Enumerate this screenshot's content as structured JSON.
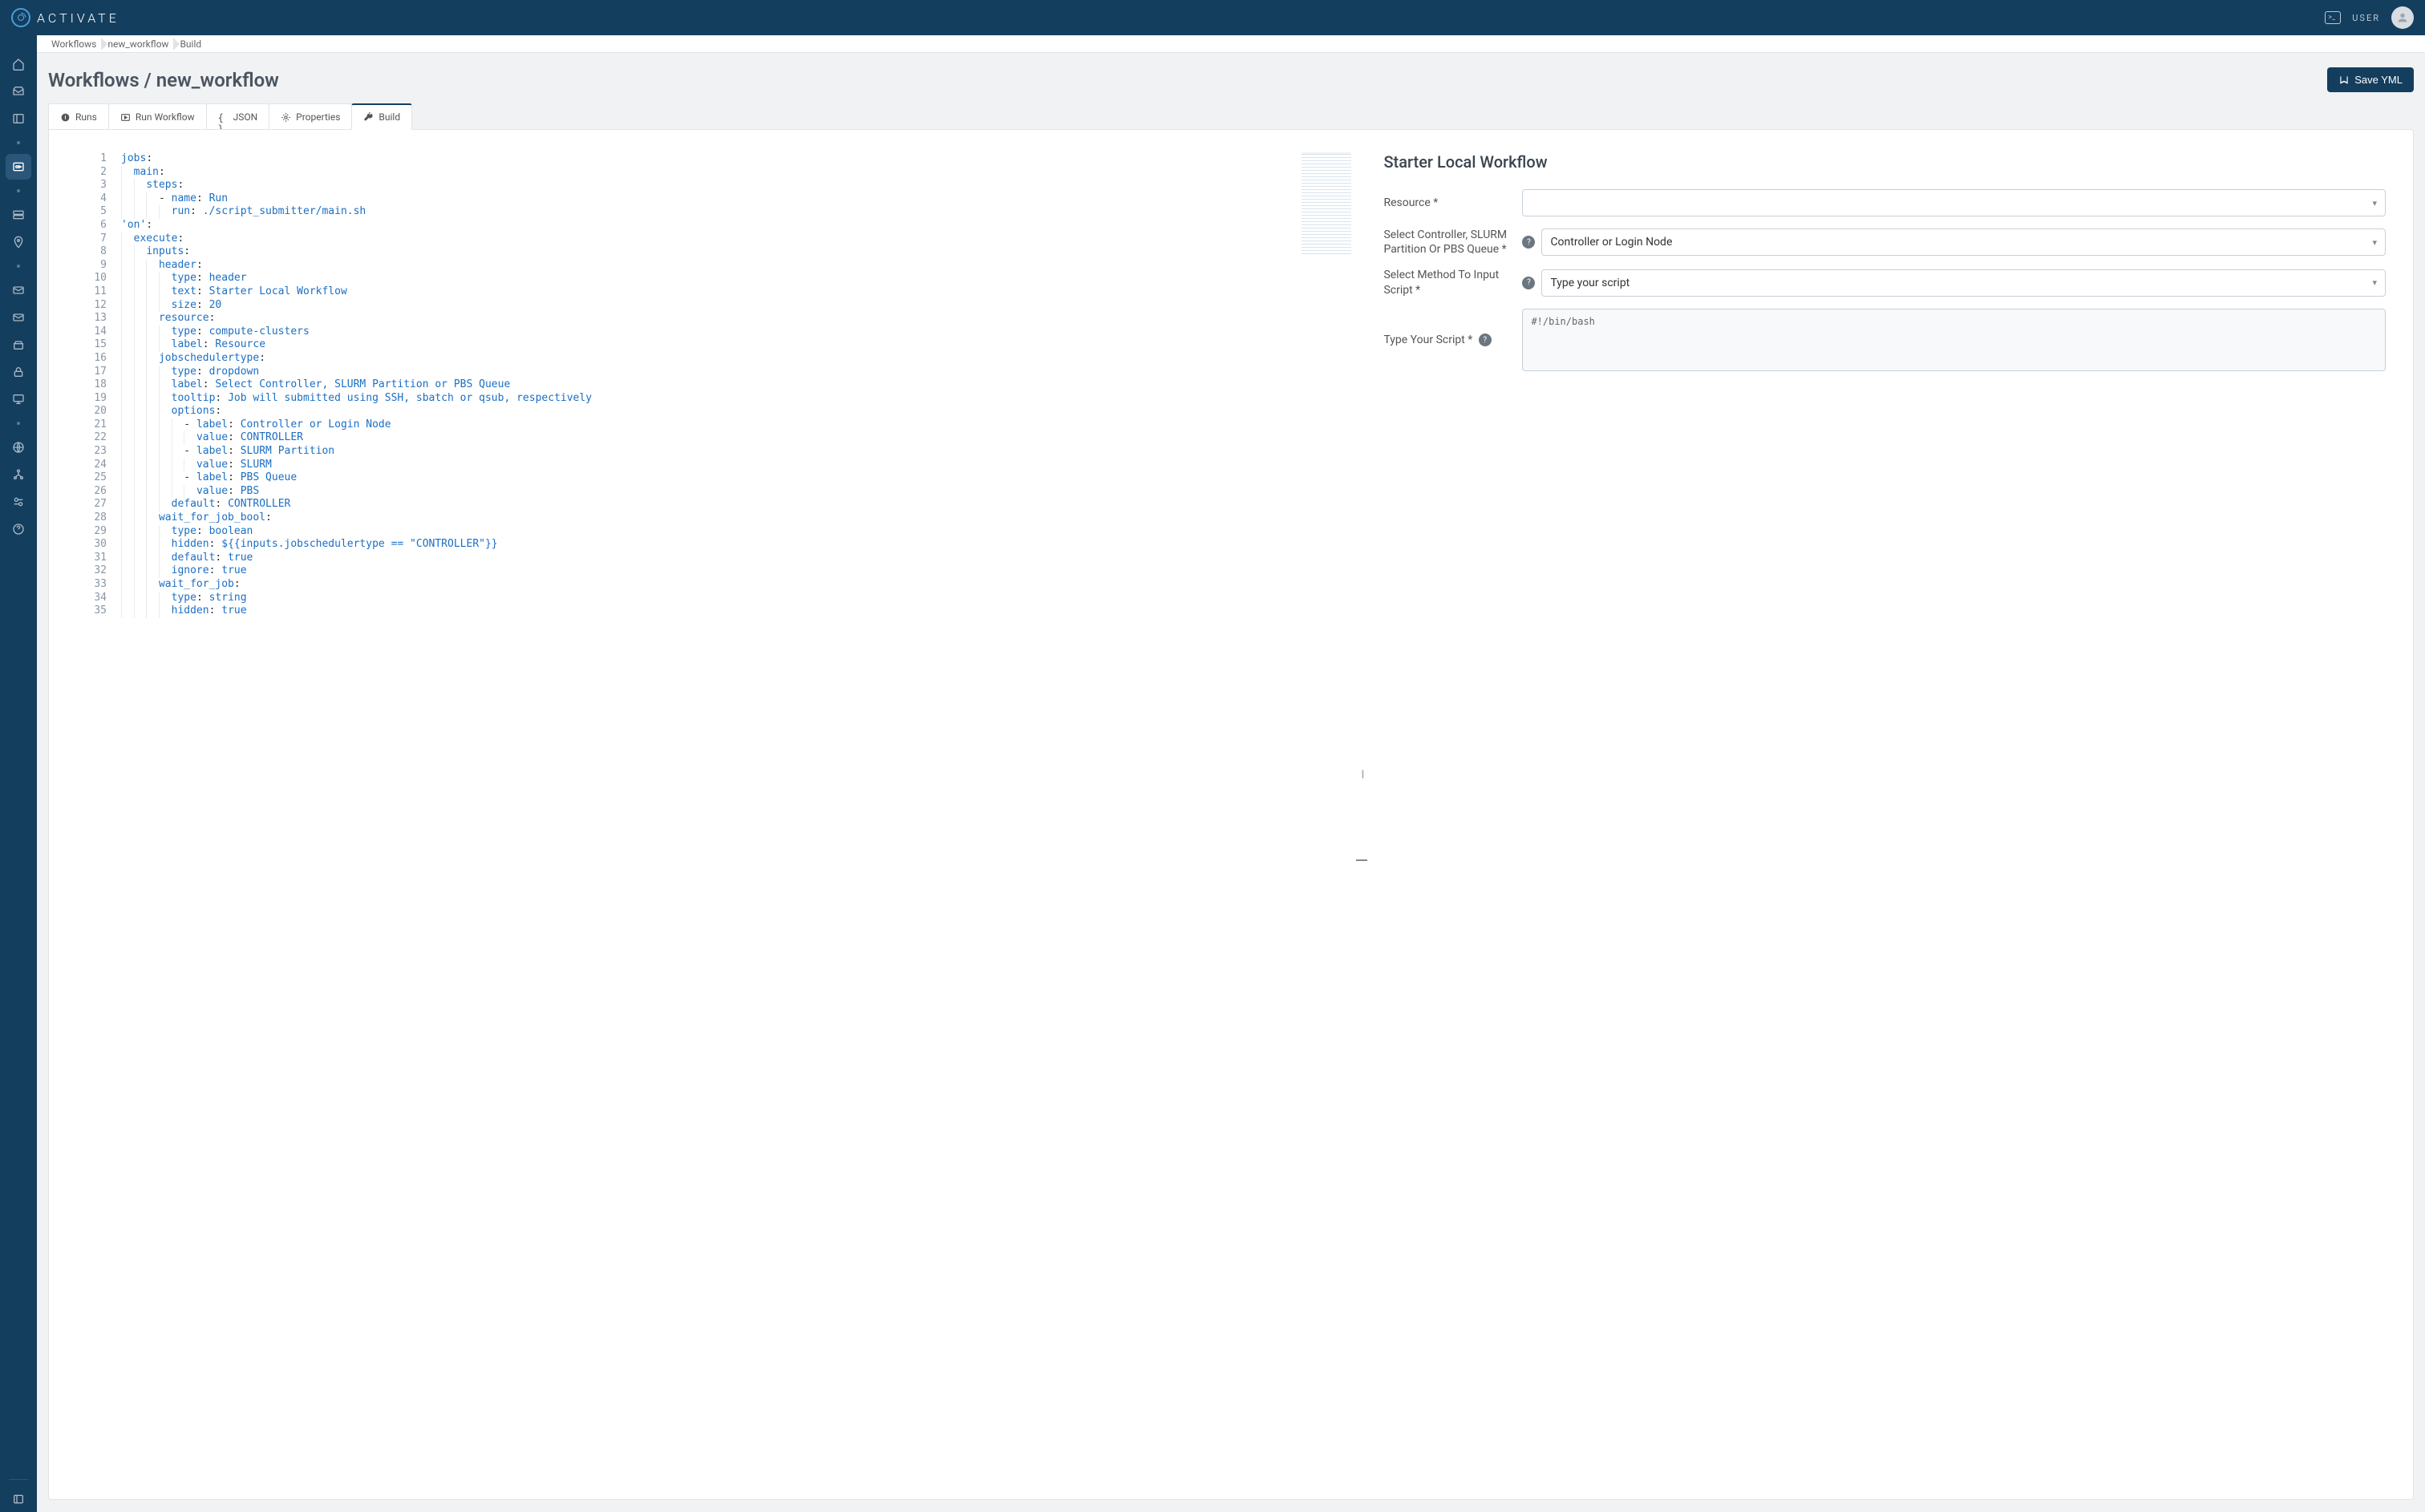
{
  "brand": "ACTIVATE",
  "user_label": "USER",
  "breadcrumb": [
    "Workflows",
    "new_workflow",
    "Build"
  ],
  "page_title": "Workflows / new_workflow",
  "save_button": "Save YML",
  "tabs": [
    {
      "id": "runs",
      "label": "Runs"
    },
    {
      "id": "run-workflow",
      "label": "Run Workflow"
    },
    {
      "id": "json",
      "label": "JSON"
    },
    {
      "id": "properties",
      "label": "Properties"
    },
    {
      "id": "build",
      "label": "Build"
    }
  ],
  "active_tab": "build",
  "code_lines": [
    {
      "n": 1,
      "indent": 0,
      "tokens": [
        [
          "key",
          "jobs"
        ],
        [
          "punc",
          ":"
        ]
      ]
    },
    {
      "n": 2,
      "indent": 1,
      "tokens": [
        [
          "key",
          "main"
        ],
        [
          "punc",
          ":"
        ]
      ]
    },
    {
      "n": 3,
      "indent": 2,
      "tokens": [
        [
          "key",
          "steps"
        ],
        [
          "punc",
          ":"
        ]
      ]
    },
    {
      "n": 4,
      "indent": 3,
      "tokens": [
        [
          "punc",
          "- "
        ],
        [
          "key",
          "name"
        ],
        [
          "punc",
          ": "
        ],
        [
          "str",
          "Run"
        ]
      ]
    },
    {
      "n": 5,
      "indent": 4,
      "tokens": [
        [
          "key",
          "run"
        ],
        [
          "punc",
          ": "
        ],
        [
          "str",
          "./script_submitter/main.sh"
        ]
      ]
    },
    {
      "n": 6,
      "indent": 0,
      "tokens": [
        [
          "str",
          "'on'"
        ],
        [
          "punc",
          ":"
        ]
      ]
    },
    {
      "n": 7,
      "indent": 1,
      "tokens": [
        [
          "key",
          "execute"
        ],
        [
          "punc",
          ":"
        ]
      ]
    },
    {
      "n": 8,
      "indent": 2,
      "tokens": [
        [
          "key",
          "inputs"
        ],
        [
          "punc",
          ":"
        ]
      ]
    },
    {
      "n": 9,
      "indent": 3,
      "tokens": [
        [
          "key",
          "header"
        ],
        [
          "punc",
          ":"
        ]
      ]
    },
    {
      "n": 10,
      "indent": 4,
      "tokens": [
        [
          "key",
          "type"
        ],
        [
          "punc",
          ": "
        ],
        [
          "str",
          "header"
        ]
      ]
    },
    {
      "n": 11,
      "indent": 4,
      "tokens": [
        [
          "key",
          "text"
        ],
        [
          "punc",
          ": "
        ],
        [
          "str",
          "Starter Local Workflow"
        ]
      ]
    },
    {
      "n": 12,
      "indent": 4,
      "tokens": [
        [
          "key",
          "size"
        ],
        [
          "punc",
          ": "
        ],
        [
          "str",
          "20"
        ]
      ]
    },
    {
      "n": 13,
      "indent": 3,
      "tokens": [
        [
          "key",
          "resource"
        ],
        [
          "punc",
          ":"
        ]
      ]
    },
    {
      "n": 14,
      "indent": 4,
      "tokens": [
        [
          "key",
          "type"
        ],
        [
          "punc",
          ": "
        ],
        [
          "str",
          "compute-clusters"
        ]
      ]
    },
    {
      "n": 15,
      "indent": 4,
      "tokens": [
        [
          "key",
          "label"
        ],
        [
          "punc",
          ": "
        ],
        [
          "str",
          "Resource"
        ]
      ]
    },
    {
      "n": 16,
      "indent": 3,
      "tokens": [
        [
          "key",
          "jobschedulertype"
        ],
        [
          "punc",
          ":"
        ]
      ]
    },
    {
      "n": 17,
      "indent": 4,
      "tokens": [
        [
          "key",
          "type"
        ],
        [
          "punc",
          ": "
        ],
        [
          "str",
          "dropdown"
        ]
      ]
    },
    {
      "n": 18,
      "indent": 4,
      "tokens": [
        [
          "key",
          "label"
        ],
        [
          "punc",
          ": "
        ],
        [
          "str",
          "Select Controller, SLURM Partition or PBS Queue"
        ]
      ]
    },
    {
      "n": 19,
      "indent": 4,
      "tokens": [
        [
          "key",
          "tooltip"
        ],
        [
          "punc",
          ": "
        ],
        [
          "str",
          "Job will submitted using SSH, sbatch or qsub, respectively"
        ]
      ]
    },
    {
      "n": 20,
      "indent": 4,
      "tokens": [
        [
          "key",
          "options"
        ],
        [
          "punc",
          ":"
        ]
      ]
    },
    {
      "n": 21,
      "indent": 5,
      "tokens": [
        [
          "punc",
          "- "
        ],
        [
          "key",
          "label"
        ],
        [
          "punc",
          ": "
        ],
        [
          "str",
          "Controller or Login Node"
        ]
      ]
    },
    {
      "n": 22,
      "indent": 6,
      "tokens": [
        [
          "key",
          "value"
        ],
        [
          "punc",
          ": "
        ],
        [
          "str",
          "CONTROLLER"
        ]
      ]
    },
    {
      "n": 23,
      "indent": 5,
      "tokens": [
        [
          "punc",
          "- "
        ],
        [
          "key",
          "label"
        ],
        [
          "punc",
          ": "
        ],
        [
          "str",
          "SLURM Partition"
        ]
      ]
    },
    {
      "n": 24,
      "indent": 6,
      "tokens": [
        [
          "key",
          "value"
        ],
        [
          "punc",
          ": "
        ],
        [
          "str",
          "SLURM"
        ]
      ]
    },
    {
      "n": 25,
      "indent": 5,
      "tokens": [
        [
          "punc",
          "- "
        ],
        [
          "key",
          "label"
        ],
        [
          "punc",
          ": "
        ],
        [
          "str",
          "PBS Queue"
        ]
      ]
    },
    {
      "n": 26,
      "indent": 6,
      "tokens": [
        [
          "key",
          "value"
        ],
        [
          "punc",
          ": "
        ],
        [
          "str",
          "PBS"
        ]
      ]
    },
    {
      "n": 27,
      "indent": 4,
      "tokens": [
        [
          "key",
          "default"
        ],
        [
          "punc",
          ": "
        ],
        [
          "str",
          "CONTROLLER"
        ]
      ]
    },
    {
      "n": 28,
      "indent": 3,
      "tokens": [
        [
          "key",
          "wait_for_job_bool"
        ],
        [
          "punc",
          ":"
        ]
      ]
    },
    {
      "n": 29,
      "indent": 4,
      "tokens": [
        [
          "key",
          "type"
        ],
        [
          "punc",
          ": "
        ],
        [
          "str",
          "boolean"
        ]
      ]
    },
    {
      "n": 30,
      "indent": 4,
      "tokens": [
        [
          "key",
          "hidden"
        ],
        [
          "punc",
          ": "
        ],
        [
          "str",
          "${{inputs.jobschedulertype == \"CONTROLLER\"}}"
        ]
      ]
    },
    {
      "n": 31,
      "indent": 4,
      "tokens": [
        [
          "key",
          "default"
        ],
        [
          "punc",
          ": "
        ],
        [
          "str",
          "true"
        ]
      ]
    },
    {
      "n": 32,
      "indent": 4,
      "tokens": [
        [
          "key",
          "ignore"
        ],
        [
          "punc",
          ": "
        ],
        [
          "str",
          "true"
        ]
      ]
    },
    {
      "n": 33,
      "indent": 3,
      "tokens": [
        [
          "key",
          "wait_for_job"
        ],
        [
          "punc",
          ":"
        ]
      ]
    },
    {
      "n": 34,
      "indent": 4,
      "tokens": [
        [
          "key",
          "type"
        ],
        [
          "punc",
          ": "
        ],
        [
          "str",
          "string"
        ]
      ]
    },
    {
      "n": 35,
      "indent": 4,
      "tokens": [
        [
          "key",
          "hidden"
        ],
        [
          "punc",
          ": "
        ],
        [
          "str",
          "true"
        ]
      ]
    }
  ],
  "form": {
    "title": "Starter Local Workflow",
    "fields": {
      "resource": {
        "label": "Resource *",
        "value": "",
        "help": false
      },
      "scheduler": {
        "label": "Select Controller, SLURM Partition Or PBS Queue *",
        "value": "Controller or Login Node",
        "help": true
      },
      "method": {
        "label": "Select Method To Input Script *",
        "value": "Type your script",
        "help": true
      },
      "script": {
        "label": "Type Your Script *",
        "value": "#!/bin/bash",
        "help_inline": true
      }
    }
  }
}
